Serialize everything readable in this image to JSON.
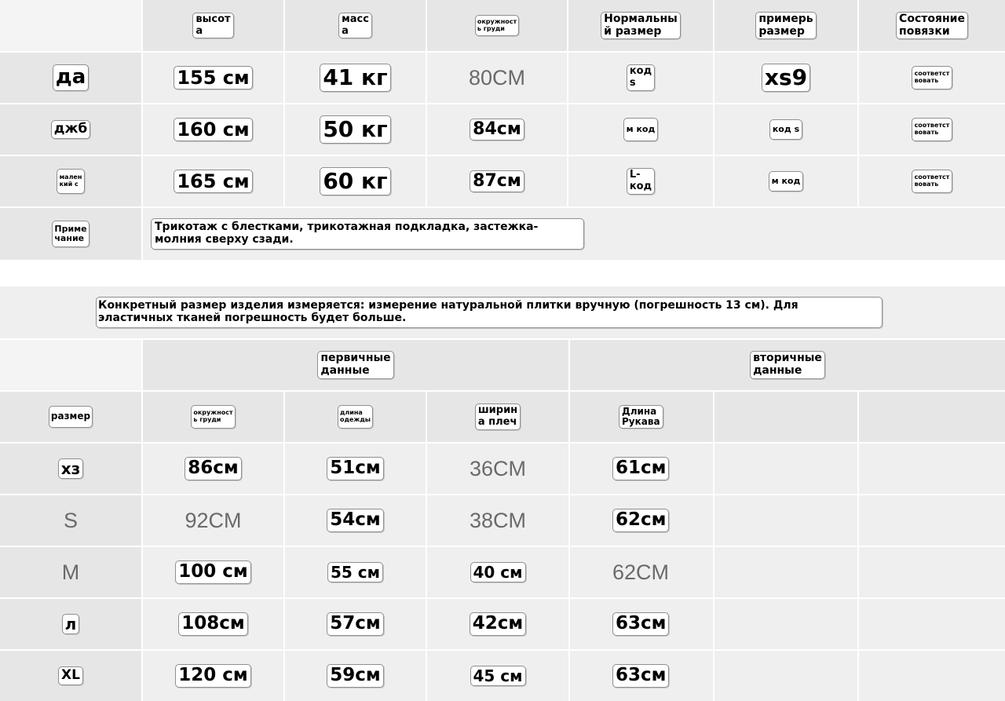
{
  "table1": {
    "headers": [
      "",
      "высот\nа",
      "масс\nа",
      "окружност\nь груди",
      "Нормальны\nй размер",
      "примерь\nразмер",
      "Состояние\nповязки"
    ],
    "rows": [
      [
        "да",
        "155 см",
        "41 кг",
        "80CM",
        "код\ns",
        "xs9",
        "соответст\nвовать"
      ],
      [
        "джб",
        "160 см",
        "50 кг",
        "84см",
        "м код",
        "код s",
        "соответст\nвовать"
      ],
      [
        "мален\nкий с",
        "165 см",
        "60 кг",
        "87см",
        "L-\nкод",
        "м код",
        "соответст\nвовать"
      ]
    ],
    "note_label": "Приме\nчание",
    "note_text": "Трикотаж с блестками, трикотажная подкладка, застежка-\nмолния сверху сзади."
  },
  "table2": {
    "measure_note": "Конкретный размер изделия измеряется: измерение натуральной плитки вручную (погрешность 13 см). Для\nэластичных тканей погрешность будет больше.",
    "group_primary": "первичные\nданные",
    "group_secondary": "вторичные\nданные",
    "headers": [
      "размер",
      "окружност\nь груди",
      "длина\nодежды",
      "ширин\nа плеч",
      "Длина\nРукава",
      "",
      ""
    ],
    "rows": [
      [
        "хз",
        "86см",
        "51см",
        "36CM",
        "61см"
      ],
      [
        "S",
        "92CM",
        "54см",
        "38CM",
        "62см"
      ],
      [
        "M",
        "100 см",
        "55 см",
        "40 см",
        "62CM"
      ],
      [
        "л",
        "108см",
        "57см",
        "42см",
        "63см"
      ],
      [
        "XL",
        "120 см",
        "59см",
        "45 см",
        "63см"
      ]
    ]
  }
}
